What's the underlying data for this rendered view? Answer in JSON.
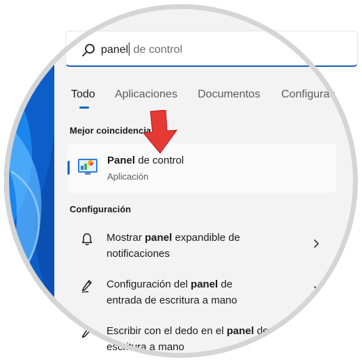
{
  "search": {
    "typed": "panel",
    "suggestion": " de control"
  },
  "tabs": [
    "Todo",
    "Aplicaciones",
    "Documentos",
    "Configurac"
  ],
  "best_match": {
    "heading": "Mejor coincidencia",
    "title_bold": "Panel",
    "title_rest": " de control",
    "subtitle": "Aplicación"
  },
  "settings": {
    "heading": "Configuración",
    "items": [
      {
        "line1_before": "Mostrar ",
        "line1_bold": "panel",
        "line1_after": " expandible de",
        "line2_before": "notificaciones",
        "line2_bold": "",
        "line2_after": "",
        "icon": "bell-icon"
      },
      {
        "line1_before": "Configuración del ",
        "line1_bold": "panel",
        "line1_after": " de",
        "line2_before": "entrada de escritura a mano",
        "line2_bold": "",
        "line2_after": "",
        "icon": "pen-icon"
      },
      {
        "line1_before": "Escribir con el dedo en el ",
        "line1_bold": "panel",
        "line1_after": " de",
        "line2_before": "escritura a mano",
        "line2_bold": "",
        "line2_after": "",
        "icon": "pen-icon"
      }
    ]
  },
  "colors": {
    "accent": "#0067c0",
    "arrow": "#e53935",
    "wallpaper": "#0d5ec9"
  }
}
